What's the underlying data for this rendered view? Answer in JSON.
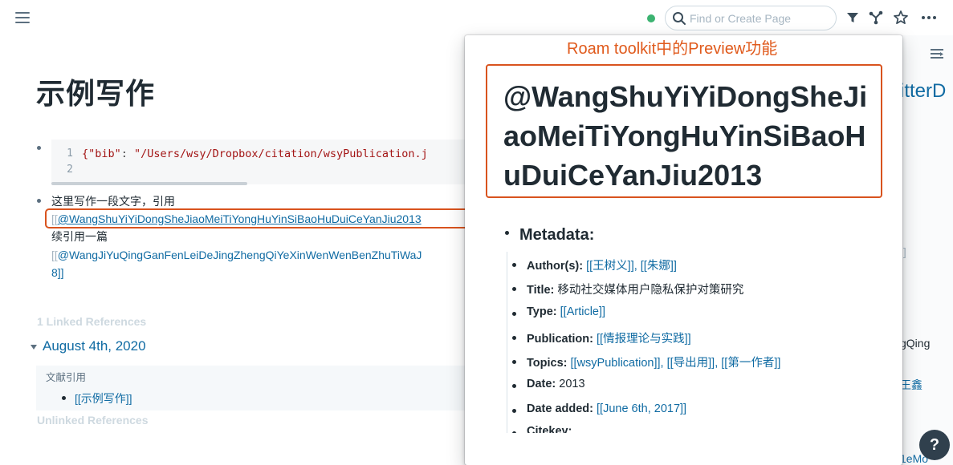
{
  "topbar": {
    "search_placeholder": "Find or Create Page"
  },
  "page": {
    "title": "示例写作",
    "code_lines": [
      "1",
      "2"
    ],
    "code_key": "{\"bib\"",
    "code_colon": ": ",
    "code_value": "\"/Users/wsy/Dropbox/citation/wsyPublication.j",
    "block_line1": "这里写作一段文字，引用",
    "ref1_open": "[[",
    "ref1_text": "@WangShuYiYiDongSheJiaoMeiTiYongHuYinSiBaoHuDuiCeYanJiu2013",
    "block_line3": "续引用一篇",
    "ref2_open": "[[",
    "ref2_text": "@WangJiYuQingGanFenLeiDeJingZhengQiYeXinWenWenBenZhuTiWaJ",
    "ref2_tail": "8]]",
    "linked_refs_label": "1 Linked References",
    "date_heading": "August 4th, 2020",
    "ref_parent": "文献引用",
    "ref_child": "[[示例写作]]",
    "unlinked_refs_label": "Unlinked References"
  },
  "sidebar_peek": {
    "title_fragment": "itterD",
    "brackets": "]]",
    "qing": "gQing",
    "xin": "王鑫",
    "bottom": "1eMo"
  },
  "annotation": "Roam toolkit中的Preview功能",
  "preview": {
    "title": "@WangShuYiYiDongSheJiaoMeiTiYongHuYinSiBaoHuDuiCeYanJiu2013",
    "metadata_heading": "Metadata:",
    "rows": [
      {
        "label": "Author(s):",
        "value": "[[王树义]], [[朱娜]]"
      },
      {
        "label": "Title:",
        "value": "移动社交媒体用户隐私保护对策研究"
      },
      {
        "label": "Type:",
        "value": "[[Article]]"
      },
      {
        "label": "Publication:",
        "value": "[[情报理论与实践]]"
      },
      {
        "label": "Topics:",
        "value": "[[wsyPublication]], [[导出用]], [[第一作者]]"
      },
      {
        "label": "Date:",
        "value": "2013"
      },
      {
        "label": "Date added:",
        "value": "[[June 6th, 2017]]"
      },
      {
        "label": "Citekey:",
        "value": ""
      }
    ]
  },
  "help_label": "?",
  "colors": {
    "accent": "#106ba3",
    "highlight_box": "#d9531e",
    "annotation_text": "#e05a1c",
    "status_dot": "#3cb371"
  }
}
